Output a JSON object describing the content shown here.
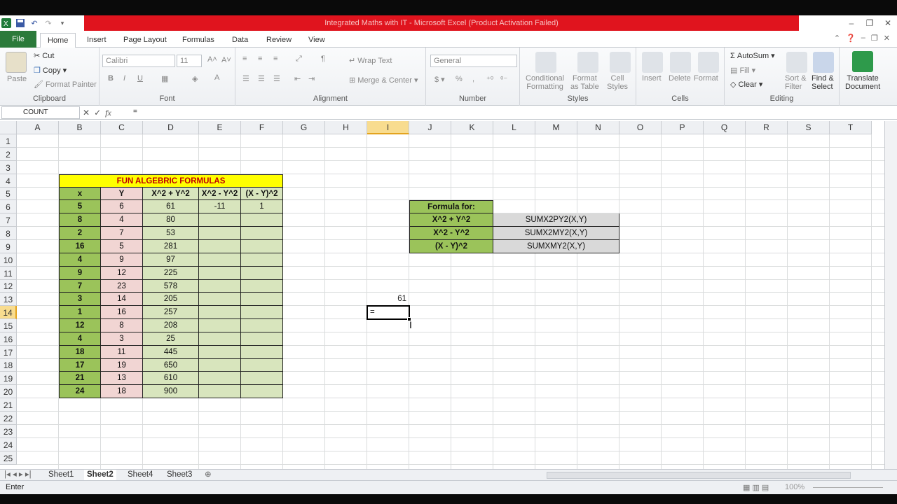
{
  "window": {
    "title": "Integrated Maths with IT  -  Microsoft Excel (Product Activation Failed)"
  },
  "qat_icons": [
    "excel-logo-icon",
    "save-icon",
    "undo-icon",
    "redo-icon",
    "customize-icon"
  ],
  "tabs": [
    {
      "label": "File",
      "active": false
    },
    {
      "label": "Home",
      "active": true
    },
    {
      "label": "Insert"
    },
    {
      "label": "Page Layout"
    },
    {
      "label": "Formulas"
    },
    {
      "label": "Data"
    },
    {
      "label": "Review"
    },
    {
      "label": "View"
    }
  ],
  "ribbon": {
    "clipboard": {
      "label": "Clipboard",
      "paste": "Paste",
      "cut": "Cut",
      "copy": "Copy",
      "format_painter": "Format Painter"
    },
    "font": {
      "label": "Font",
      "font_name": "Calibri",
      "font_size": "11"
    },
    "alignment": {
      "label": "Alignment",
      "wrap_text": "Wrap Text",
      "merge_center": "Merge & Center"
    },
    "number": {
      "label": "Number",
      "format": "General"
    },
    "styles": {
      "label": "Styles",
      "conditional": "Conditional\nFormatting",
      "format_table": "Format\nas Table",
      "cell_styles": "Cell\nStyles"
    },
    "cells": {
      "label": "Cells",
      "insert": "Insert",
      "delete": "Delete",
      "format": "Format"
    },
    "editing": {
      "label": "Editing",
      "autosum": "AutoSum",
      "fill": "Fill",
      "clear": "Clear",
      "sort": "Sort &\nFilter",
      "find": "Find &\nSelect"
    },
    "translate": {
      "label": "Translate\nDocument"
    }
  },
  "formula_bar": {
    "name_box": "COUNT",
    "formula": "="
  },
  "columns": [
    "A",
    "B",
    "C",
    "D",
    "E",
    "F",
    "G",
    "H",
    "I",
    "J",
    "K",
    "L",
    "M",
    "N",
    "O",
    "P",
    "Q",
    "R",
    "S",
    "T"
  ],
  "selected_column": "I",
  "rows": [
    "1",
    "2",
    "3",
    "4",
    "5",
    "6",
    "7",
    "8",
    "9",
    "10",
    "11",
    "12",
    "13",
    "14",
    "15",
    "16",
    "17",
    "18",
    "19",
    "20",
    "21",
    "22",
    "23",
    "24",
    "25"
  ],
  "selected_row": "14",
  "table": {
    "title": "FUN ALGEBRIC FORMULAS",
    "headers": [
      "x",
      "Y",
      "X^2 + Y^2",
      "X^2 - Y^2",
      "(X - Y)^2"
    ],
    "rows": [
      [
        "5",
        "6",
        "61",
        "-11",
        "1"
      ],
      [
        "8",
        "4",
        "80",
        "",
        ""
      ],
      [
        "2",
        "7",
        "53",
        "",
        ""
      ],
      [
        "16",
        "5",
        "281",
        "",
        ""
      ],
      [
        "4",
        "9",
        "97",
        "",
        ""
      ],
      [
        "9",
        "12",
        "225",
        "",
        ""
      ],
      [
        "7",
        "23",
        "578",
        "",
        ""
      ],
      [
        "3",
        "14",
        "205",
        "",
        ""
      ],
      [
        "1",
        "16",
        "257",
        "",
        ""
      ],
      [
        "12",
        "8",
        "208",
        "",
        ""
      ],
      [
        "4",
        "3",
        "25",
        "",
        ""
      ],
      [
        "18",
        "11",
        "445",
        "",
        ""
      ],
      [
        "17",
        "19",
        "650",
        "",
        ""
      ],
      [
        "21",
        "13",
        "610",
        "",
        ""
      ],
      [
        "24",
        "18",
        "900",
        "",
        ""
      ]
    ]
  },
  "formula_table": {
    "header": "Formula for:",
    "rows": [
      [
        "X^2 + Y^2",
        "SUMX2PY2(X,Y)"
      ],
      [
        "X^2 - Y^2",
        "SUMX2MY2(X,Y)"
      ],
      [
        "(X - Y)^2",
        "SUMXMY2(X,Y)"
      ]
    ]
  },
  "loose_cells": {
    "i13": "61",
    "i14": "="
  },
  "sheets": [
    {
      "label": "Sheet1",
      "active": false
    },
    {
      "label": "Sheet2",
      "active": true
    },
    {
      "label": "Sheet4",
      "active": false
    },
    {
      "label": "Sheet3",
      "active": false
    }
  ],
  "status": {
    "mode": "Enter",
    "zoom": "100%"
  }
}
